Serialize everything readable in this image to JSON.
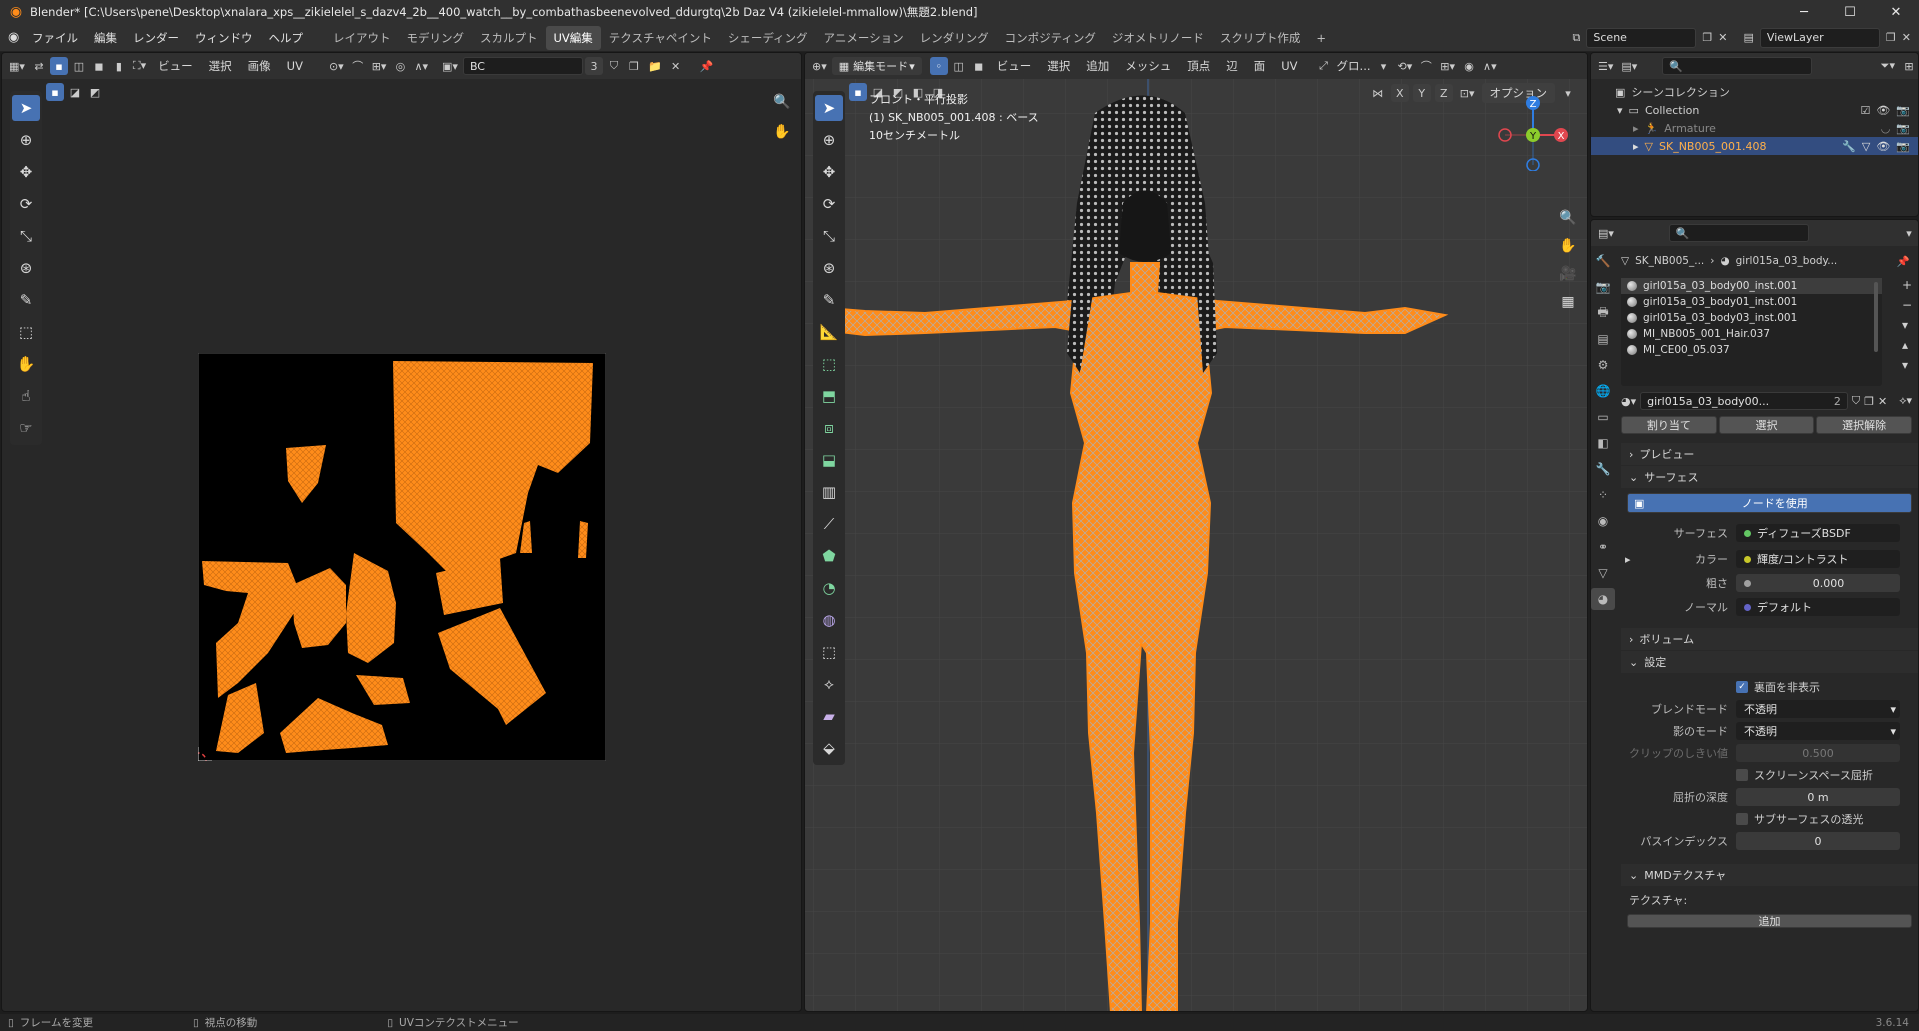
{
  "window": {
    "title": "Blender* [C:\\Users\\pene\\Desktop\\xnalara_xps__zikielelel_s_dazv4_2b__400_watch__by_combathasbeenevolved_ddurgtq\\2b Daz V4 (zikielelel-mmallow)\\無題2.blend]",
    "controls": {
      "minimize": "─",
      "maximize": "☐",
      "close": "✕"
    }
  },
  "menubar": {
    "menus": [
      "ファイル",
      "編集",
      "レンダー",
      "ウィンドウ",
      "ヘルプ"
    ],
    "workspaces": [
      "レイアウト",
      "モデリング",
      "スカルプト",
      "UV編集",
      "テクスチャペイント",
      "シェーディング",
      "アニメーション",
      "レンダリング",
      "コンポジティング",
      "ジオメトリノード",
      "スクリプト作成"
    ],
    "active_workspace": "UV編集",
    "scene": "Scene",
    "view_layer": "ViewLayer"
  },
  "uv_editor": {
    "menus": [
      "ビュー",
      "選択",
      "画像",
      "UV"
    ],
    "image_name": "BC",
    "user_count": "3"
  },
  "viewport": {
    "mode": "編集モード",
    "menus": [
      "ビュー",
      "選択",
      "追加",
      "メッシュ",
      "頂点",
      "辺",
      "面",
      "UV"
    ],
    "transform_orientation": "グロ...",
    "axes": [
      "X",
      "Y",
      "Z"
    ],
    "options": "オプション",
    "overlay_text": {
      "line1": "フロント・平行投影",
      "line2": "(1) SK_NB005_001.408 : ベース",
      "line3": "10センチメートル"
    },
    "gizmo_labels": {
      "z": "Z",
      "y": "Y",
      "x": "X"
    }
  },
  "outliner": {
    "root": "シーンコレクション",
    "collection": "Collection",
    "items": [
      {
        "name": "Armature",
        "selected": false
      },
      {
        "name": "SK_NB005_001.408",
        "selected": true
      }
    ]
  },
  "properties": {
    "breadcrumb": {
      "object": "SK_NB005_...",
      "material": "girl015a_03_body..."
    },
    "material_slots": [
      "girl015a_03_body00_inst.001",
      "girl015a_03_body01_inst.001",
      "girl015a_03_body03_inst.001",
      "MI_NB005_001_Hair.037",
      "MI_CE00_05.037"
    ],
    "material_name": "girl015a_03_body00...",
    "material_users": "2",
    "slot_buttons": [
      "割り当て",
      "選択",
      "選択解除"
    ],
    "sections": {
      "preview": "プレビュー",
      "surface": "サーフェス",
      "volume": "ボリューム",
      "settings": "設定",
      "mmd": "MMDテクスチャ"
    },
    "use_nodes": "ノードを使用",
    "surface_rows": [
      {
        "label": "サーフェス",
        "value": "ディフューズBSDF",
        "color": "#63c763"
      },
      {
        "label": "カラー",
        "value": "輝度/コントラスト",
        "color": "#c7c729"
      },
      {
        "label": "粗さ",
        "value": "0.000",
        "color": "#a1a1a1"
      },
      {
        "label": "ノーマル",
        "value": "デフォルト",
        "color": "#6363c7"
      }
    ],
    "settings_rows": {
      "backface": "裏面を非表示",
      "blend_label": "ブレンドモード",
      "blend_value": "不透明",
      "shadow_label": "影のモード",
      "shadow_value": "不透明",
      "clip_label": "クリップのしきい値",
      "clip_value": "0.500",
      "ssr": "スクリーンスペース屈折",
      "refr_label": "屈折の深度",
      "refr_value": "0 m",
      "sss": "サブサーフェスの透光",
      "pass_label": "パスインデックス",
      "pass_value": "0"
    },
    "texture_label": "テクスチャ:",
    "add_label": "追加"
  },
  "statusbar": {
    "items": [
      "フレームを変更",
      "視点の移動",
      "UVコンテクストメニュー"
    ],
    "version": "3.6.14"
  },
  "colors": {
    "accent": "#4772b3",
    "mesh": "#ff8c1a",
    "selection": "#334d80"
  }
}
